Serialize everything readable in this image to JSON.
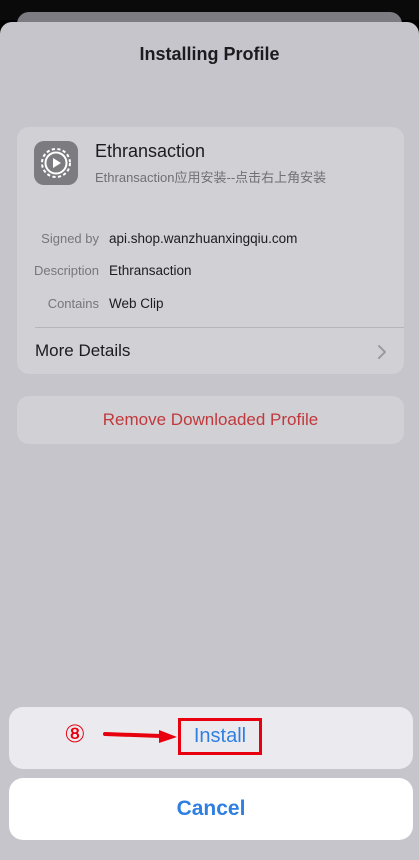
{
  "sheet": {
    "title": "Installing Profile"
  },
  "profile": {
    "name": "Ethransaction",
    "subtitle": "Ethransaction应用安装--点击右上角安装",
    "details": [
      {
        "label": "Signed by",
        "value": "api.shop.wanzhuanxingqiu.com"
      },
      {
        "label": "Description",
        "value": "Ethransaction"
      },
      {
        "label": "Contains",
        "value": "Web Clip"
      }
    ],
    "more_details_label": "More Details",
    "icon": "gear-play-icon"
  },
  "remove_button": {
    "label": "Remove Downloaded Profile"
  },
  "actions": {
    "install_label": "Install",
    "cancel_label": "Cancel",
    "step_marker": "⑧"
  },
  "colors": {
    "accent": "#2f7fe3",
    "destructive": "#c0393c",
    "annotation": "#e8000e"
  }
}
